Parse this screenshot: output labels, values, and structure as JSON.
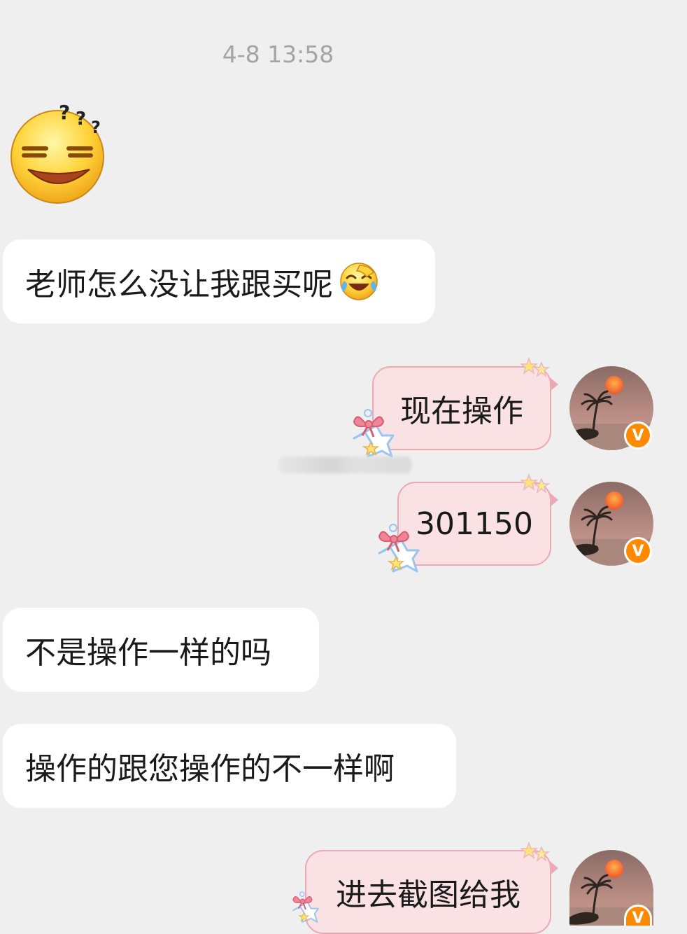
{
  "timestamp": "4-8 13:58",
  "messages": [
    {
      "side": "in",
      "type": "sticker",
      "sticker_name": "confused-grin-emoji"
    },
    {
      "side": "in",
      "text": "老师怎么没让我跟买呢",
      "emoji": "laughing-crying-emoji"
    },
    {
      "side": "out",
      "text": "现在操作"
    },
    {
      "side": "out",
      "text": "301150"
    },
    {
      "side": "in",
      "text": "不是操作一样的吗"
    },
    {
      "side": "in",
      "text": "操作的跟您操作的不一样啊"
    },
    {
      "side": "out",
      "text": "进去截图给我"
    }
  ],
  "avatar": {
    "icon": "sunset-palm-avatar",
    "badge_text": "V",
    "badge_color": "#ff8a00"
  },
  "colors": {
    "background": "#efefef",
    "incoming_bubble": "#ffffff",
    "outgoing_bubble": "#f9e1e4",
    "outgoing_border": "#eaa9b3",
    "timestamp": "#a4a4a4"
  }
}
